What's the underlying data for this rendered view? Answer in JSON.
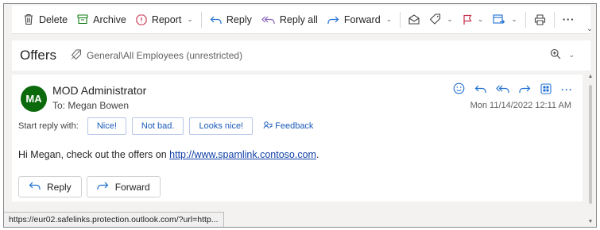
{
  "toolbar": {
    "delete": "Delete",
    "archive": "Archive",
    "report": "Report",
    "reply": "Reply",
    "reply_all": "Reply all",
    "forward": "Forward",
    "more": "···"
  },
  "subject": {
    "title": "Offers",
    "label": "General\\All Employees (unrestricted)"
  },
  "message": {
    "avatar_initials": "MA",
    "sender": "MOD Administrator",
    "to": "To:  Megan Bowen",
    "date": "Mon 11/14/2022 12:11 AM",
    "more": "···",
    "quick_reply_label": "Start reply with:",
    "quick_replies": [
      "Nice!",
      "Not bad.",
      "Looks nice!"
    ],
    "feedback": "Feedback",
    "body_prefix": "Hi Megan, check out the offers on ",
    "link_text": "http://www.spamlink.contoso.com",
    "body_suffix": ".",
    "reply_button": "Reply",
    "forward_button": "Forward"
  },
  "status_bar": {
    "url": "https://eur02.safelinks.protection.outlook.com/?url=http..."
  },
  "colors": {
    "accent": "#1b5bb8",
    "avatar": "#0b6a0b",
    "report_red": "#c4314b",
    "archive_green": "#107c10",
    "reply_all_purple": "#8764b8",
    "forward_blue": "#1f6fd1"
  },
  "icons": [
    "trash-icon",
    "archive-icon",
    "report-icon",
    "reply-icon",
    "reply-all-icon",
    "forward-icon",
    "envelope-icon",
    "tag-icon",
    "flag-icon",
    "move-icon",
    "print-icon",
    "more-icon",
    "label-icon",
    "zoom-icon",
    "emoji-icon",
    "teams-icon",
    "feedback-icon"
  ]
}
